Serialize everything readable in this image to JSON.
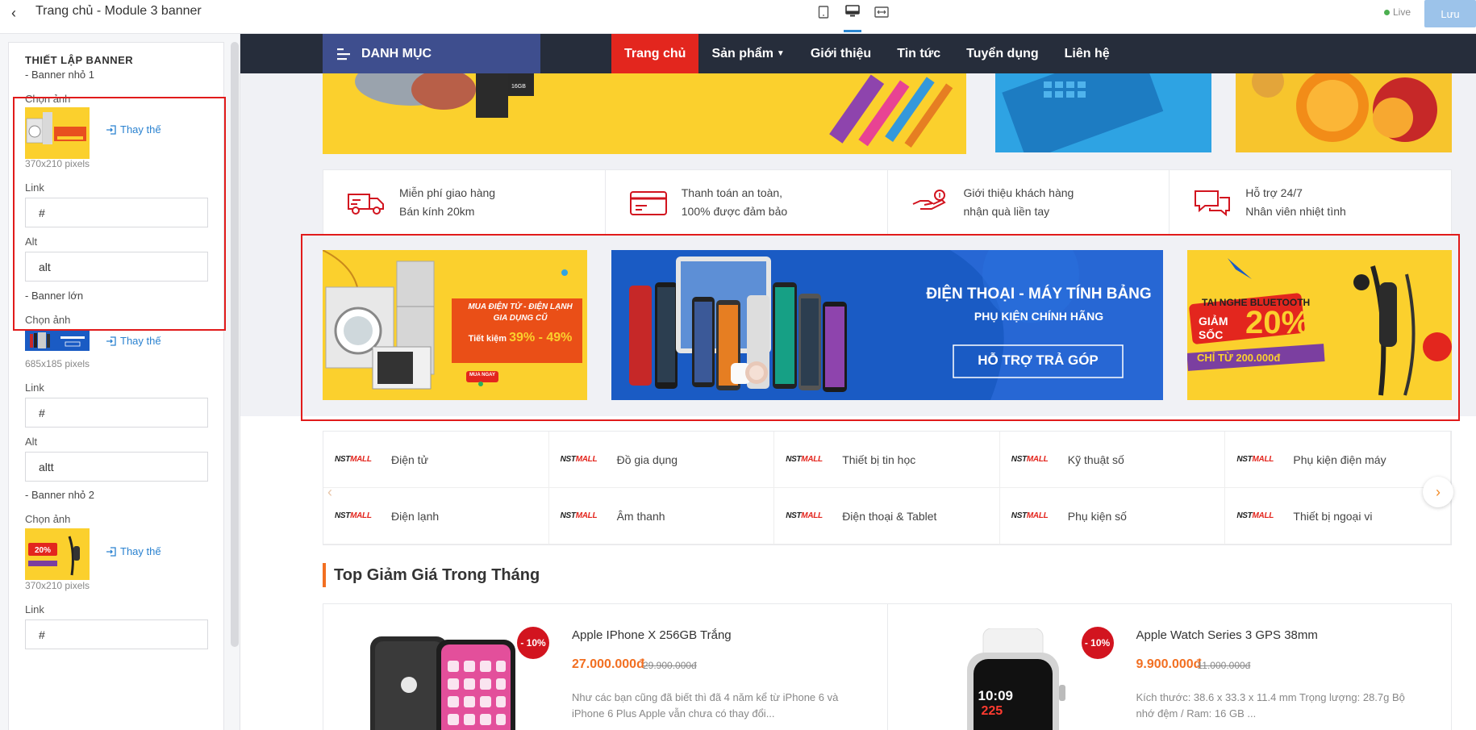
{
  "editor": {
    "title": "Trang chủ - Module 3 banner",
    "live_label": "Live",
    "save_label": "Lưu"
  },
  "panel": {
    "heading": "THIẾT LẬP BANNER",
    "banner_small_1": {
      "section": "- Banner nhỏ 1",
      "choose_label": "Chọn ảnh",
      "replace_label": "Thay thế",
      "size": "370x210 pixels",
      "link_label": "Link",
      "link_value": "#",
      "alt_label": "Alt",
      "alt_value": "alt"
    },
    "banner_large": {
      "section": "- Banner lớn",
      "choose_label": "Chọn ảnh",
      "replace_label": "Thay thế",
      "size": "685x185 pixels",
      "link_label": "Link",
      "link_value": "#",
      "alt_label": "Alt",
      "alt_value": "altt"
    },
    "banner_small_2": {
      "section": "- Banner nhỏ 2",
      "choose_label": "Chọn ảnh",
      "replace_label": "Thay thế",
      "size": "370x210 pixels",
      "link_label": "Link",
      "link_value": "#"
    }
  },
  "store": {
    "category_button": "DANH MỤC",
    "nav": [
      "Trang chủ",
      "Sản phẩm",
      "Giới thiệu",
      "Tin tức",
      "Tuyển dụng",
      "Liên hệ"
    ],
    "services": [
      {
        "line1": "Miễn phí giao hàng",
        "line2": "Bán kính 20km",
        "icon": "truck-icon"
      },
      {
        "line1": "Thanh toán an toàn,",
        "line2": "100% được đảm bảo",
        "icon": "credit-card-icon"
      },
      {
        "line1": "Giới thiệu khách hàng",
        "line2": "nhận quà liền tay",
        "icon": "hand-coin-icon"
      },
      {
        "line1": "Hỗ trợ 24/7",
        "line2": "Nhân viên nhiệt tình",
        "icon": "chat-icon"
      }
    ],
    "banner_left": {
      "headline1": "MUA ĐIỆN TỬ - ĐIỆN LẠNH",
      "headline2": "GIA DỤNG CŨ",
      "saving_prefix": "Tiết kiệm",
      "saving_value": "39% - 49%",
      "cta": "MUA NGAY"
    },
    "banner_center": {
      "title": "ĐIỆN THOẠI - MÁY TÍNH BẢNG",
      "subtitle": "PHỤ KIỆN CHÍNH HÃNG",
      "cta": "HỖ TRỢ TRẢ GÓP"
    },
    "banner_right": {
      "title": "TAI NGHE BLUETOOTH",
      "discount_label": "GIẢM SỐC",
      "discount_value": "20%",
      "price_line": "CHỈ TỪ 200.000đ"
    },
    "brand_logo_prefix": "NST",
    "brand_logo_suffix": "MALL",
    "categories": [
      "Điện tử",
      "Đồ gia dụng",
      "Thiết bị tin học",
      "Kỹ thuật số",
      "Phụ kiện điện máy",
      "Điện lạnh",
      "Âm thanh",
      "Điện thoại & Tablet",
      "Phụ kiện số",
      "Thiết bị ngoại vi"
    ],
    "section_title": "Top Giảm Giá Trong Tháng",
    "products": [
      {
        "name": "Apple IPhone X 256GB Trắng",
        "price": "27.000.000đ",
        "old_price": "29.900.000đ",
        "badge": "- 10%",
        "desc": "Như các bạn cũng đã biết thì đã 4 năm kể từ iPhone 6 và iPhone 6 Plus Apple vẫn chưa có thay đổi..."
      },
      {
        "name": "Apple Watch Series 3 GPS 38mm",
        "price": "9.900.000đ",
        "old_price": "11.000.000đ",
        "badge": "- 10%",
        "desc": "Kích thước: 38.6 x 33.3 x 11.4 mm Trọng lượng: 28.7g Bộ nhớ đệm / Ram: 16 GB ...",
        "watch_time": "10:09",
        "watch_value": "225"
      }
    ]
  },
  "colors": {
    "accent_red": "#e3261e",
    "nav_dark": "#262d3b",
    "category_blue": "#3e4e8e",
    "price_orange": "#f26f21",
    "link_blue": "#2a82d0"
  }
}
